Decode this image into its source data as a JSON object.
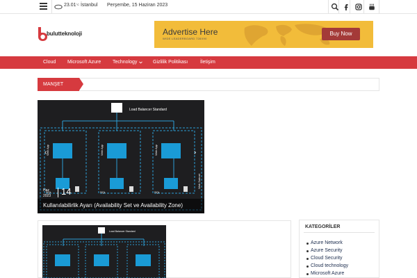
{
  "topbar": {
    "menu_icon": "hamburger-icon",
    "weather_icon": "cloud-icon",
    "temperature": "23.01",
    "temperature_unit": "°C",
    "city": "İstanbul",
    "date": "Perşembe, 15 Haziran 2023",
    "icons": [
      "search-icon",
      "facebook-icon",
      "instagram-icon",
      "youtube-icon"
    ]
  },
  "header": {
    "logo_text": "bulutteknoloji",
    "logo_color": "#d63a3f"
  },
  "ad": {
    "title": "Advertise Here",
    "subtitle": "WIDE LEADERBOARD 728X90",
    "button": "Buy Now"
  },
  "nav": {
    "items": [
      "Cloud",
      "Microsoft Azure",
      "Technology",
      "Gizlilik Politikası",
      "İletişim"
    ],
    "accent": "#d63a3f"
  },
  "manset": {
    "label": "MANŞET"
  },
  "featured": {
    "date_day": "14",
    "date_month": "Haz",
    "date_year": "2023",
    "title": "Kullanılabilirlik Ayarı (Availability Set ve Availability Zone)",
    "diagram": {
      "top_label": "Load Balancer Standard",
      "boxes": [
        "Web App",
        "Web App",
        "Web App"
      ],
      "db_labels": [
        "SQL",
        "SQL",
        "SQL"
      ],
      "subnet_label": "Web Subnet"
    }
  },
  "post_thumb": {
    "top_label": "Load Balancer Standard"
  },
  "sidebar": {
    "title": "KATEGORİLER",
    "categories": [
      "Azure Network",
      "Azure Security",
      "Cloud Security",
      "Cloud technology",
      "Microsoft Azure"
    ]
  }
}
